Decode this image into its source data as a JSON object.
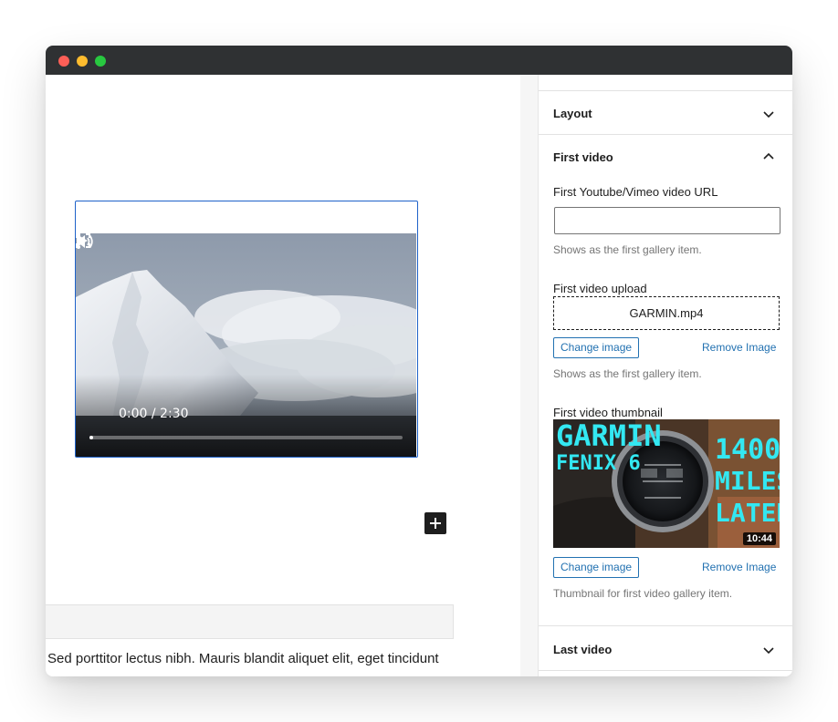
{
  "editor": {
    "video": {
      "time_display": "0:00 / 2:30",
      "progress_fraction": 0.01
    },
    "paragraph_text": "Sed porttitor lectus nibh. Mauris blandit aliquet elit, eget tincidunt"
  },
  "sidebar": {
    "panels": {
      "layout": {
        "title": "Layout",
        "state": "collapsed"
      },
      "first_video": {
        "title": "First video",
        "state": "expanded",
        "url_label": "First Youtube/Vimeo video URL",
        "url_value": "",
        "url_help": "Shows as the first gallery item.",
        "upload_label": "First video upload",
        "upload_filename": "GARMIN.mp4",
        "upload_change_label": "Change image",
        "upload_remove_label": "Remove Image",
        "upload_help": "Shows as the first gallery item.",
        "thumb_label": "First video thumbnail",
        "thumb_text": {
          "line1": "GARMIN",
          "line2": "FENIX 6",
          "line3": "1400",
          "line4": "MILES",
          "line5": "LATER",
          "duration": "10:44"
        },
        "thumb_change_label": "Change image",
        "thumb_remove_label": "Remove Image",
        "thumb_help": "Thumbnail for first video gallery item."
      },
      "last_video": {
        "title": "Last video",
        "state": "collapsed"
      }
    }
  },
  "colors": {
    "selection_border": "#1e62c9",
    "link_blue": "#2271b1",
    "titlebar": "#2f3133",
    "thumb_text": "#33e8f2"
  }
}
